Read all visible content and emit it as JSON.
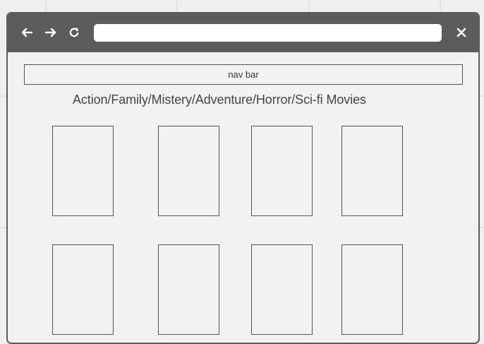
{
  "browser": {
    "back_icon": "arrow-left-icon",
    "forward_icon": "arrow-right-icon",
    "reload_icon": "reload-icon",
    "close_icon": "close-icon",
    "address_value": "",
    "chrome_color": "#5c5c5c"
  },
  "nav_bar": {
    "label": "nav bar"
  },
  "page": {
    "heading": "Action/Family/Mistery/Adventure/Horror/Sci-fi Movies"
  },
  "movie_grid": {
    "rows": 2,
    "columns": 4
  }
}
